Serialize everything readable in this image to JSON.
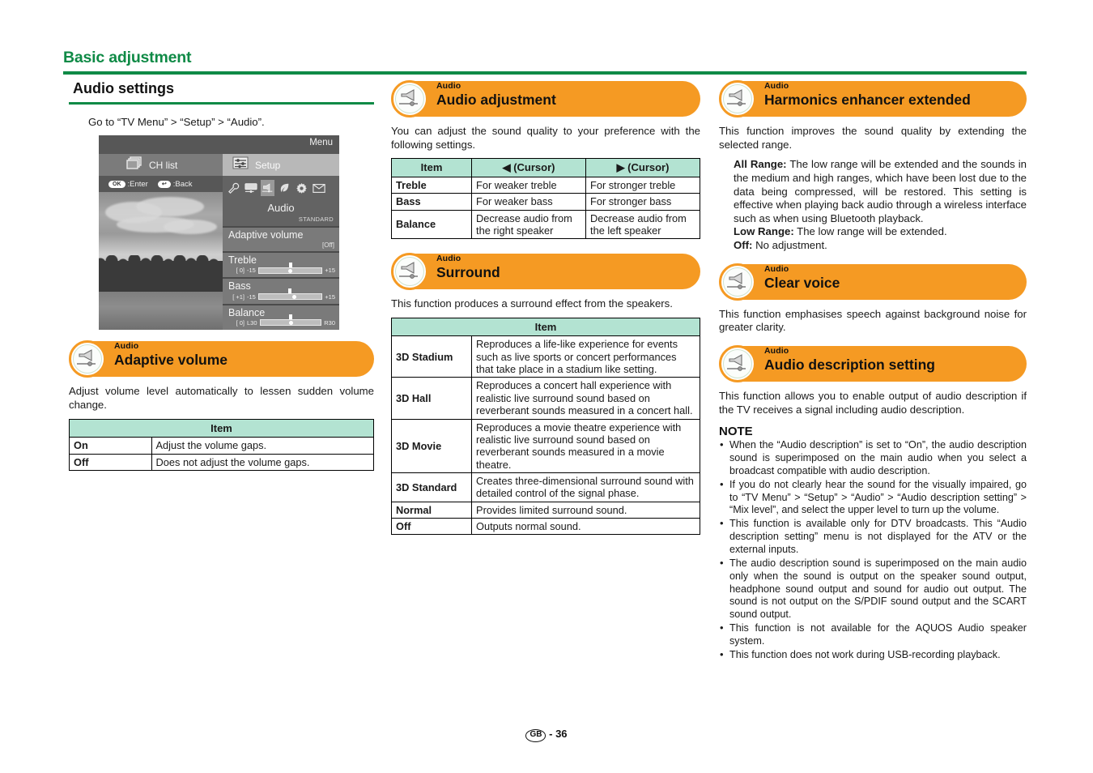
{
  "running_head": {
    "title": "Basic adjustment"
  },
  "footer": {
    "region": "GB",
    "separator": "-",
    "page_number": "36"
  },
  "left_column": {
    "section_title": "Audio settings",
    "intro": "Go to “TV Menu” > “Setup” > “Audio”.",
    "tv_osd": {
      "menu_label": "Menu",
      "tab_ch_list": "CH list",
      "tab_setup": "Setup",
      "hint_ok_key": "OK",
      "hint_ok_label": ":Enter",
      "hint_back_key": "↩",
      "hint_back_label": ":Back",
      "icons": [
        "wrench-icon",
        "picture-icon",
        "audio-icon",
        "eco-icon",
        "gear-icon",
        "mail-icon"
      ],
      "selected_icon_index": 2,
      "category_name": "Audio",
      "picture_mode": "STANDARD",
      "options": [
        {
          "label": "Adaptive volume",
          "value": "[Off]"
        }
      ],
      "sliders": [
        {
          "label": "Treble",
          "value": "[  0]",
          "min_label": "-15",
          "max_label": "+15",
          "percent": 50
        },
        {
          "label": "Bass",
          "value": "[ +1]",
          "min_label": "-15",
          "max_label": "+15",
          "percent": 55
        },
        {
          "label": "Balance",
          "value": "[  0]",
          "min_label": "L30",
          "max_label": "R30",
          "percent": 50
        }
      ]
    },
    "adaptive_volume": {
      "category": "Audio",
      "title": "Adaptive volume",
      "description": "Adjust volume level automatically to lessen sudden volume change.",
      "table": {
        "header": "Item",
        "rows": [
          {
            "key": "On",
            "desc": "Adjust the volume gaps."
          },
          {
            "key": "Off",
            "desc": "Does not adjust the volume gaps."
          }
        ]
      }
    }
  },
  "middle_column": {
    "audio_adjustment": {
      "category": "Audio",
      "title": "Audio adjustment",
      "description": "You can adjust the sound quality to your preference with the following settings.",
      "table": {
        "headers": [
          "Item",
          "◀ (Cursor)",
          "▶ (Cursor)"
        ],
        "rows": [
          {
            "item": "Treble",
            "left": "For weaker treble",
            "right": "For stronger treble"
          },
          {
            "item": "Bass",
            "left": "For weaker bass",
            "right": "For stronger bass"
          },
          {
            "item": "Balance",
            "left": "Decrease audio from the right speaker",
            "right": "Decrease audio from the left speaker"
          }
        ]
      }
    },
    "surround": {
      "category": "Audio",
      "title": "Surround",
      "description": "This function produces a surround effect from the speakers.",
      "table": {
        "header": "Item",
        "rows": [
          {
            "key": "3D Stadium",
            "desc": "Reproduces a life-like experience for events such as live sports or concert performances that take place in a stadium like setting."
          },
          {
            "key": "3D Hall",
            "desc": "Reproduces a concert hall experience with realistic live surround sound based on reverberant sounds measured in a concert hall."
          },
          {
            "key": "3D Movie",
            "desc": "Reproduces a movie theatre experience with realistic live surround sound based on reverberant sounds measured in a movie theatre."
          },
          {
            "key": "3D Standard",
            "desc": "Creates three-dimensional surround sound with detailed control of the signal phase."
          },
          {
            "key": "Normal",
            "desc": "Provides limited surround sound."
          },
          {
            "key": "Off",
            "desc": "Outputs normal sound."
          }
        ]
      }
    }
  },
  "right_column": {
    "harmonics_enhancer": {
      "category": "Audio",
      "title": "Harmonics enhancer extended",
      "description": "This function improves the sound quality by extending the selected range.",
      "options": [
        {
          "term": "All Range:",
          "text": " The low range will be extended and the sounds in the medium and high ranges, which have been lost due to the data being compressed, will be restored. This setting is effective when playing back audio through a wireless interface such as when using Bluetooth playback."
        },
        {
          "term": "Low Range:",
          "text": " The low range will be extended."
        },
        {
          "term": "Off:",
          "text": " No adjustment."
        }
      ]
    },
    "clear_voice": {
      "category": "Audio",
      "title": "Clear voice",
      "description": "This function emphasises speech against background noise for greater clarity."
    },
    "audio_description": {
      "category": "Audio",
      "title": "Audio description setting",
      "description": "This function allows you to enable output of audio description if the TV receives a signal including audio description.",
      "note_title": "NOTE",
      "notes": [
        "When the “Audio description” is set to “On”, the audio description sound is superimposed on the main audio when you select a broadcast compatible with audio description.",
        "If you do not clearly hear the sound for the visually impaired, go to “TV Menu” > “Setup” > “Audio” > “Audio description setting” > “Mix level”, and select the upper level to turn up the volume.",
        "This function is available only for DTV broadcasts. This “Audio description setting” menu is not displayed for the ATV or the external inputs.",
        "The audio description sound is superimposed on the main audio only when the sound is output on the speaker sound output, headphone sound output and sound for audio out output. The sound is not output on the S/PDIF sound output and the SCART sound output.",
        "This function is not available for the AQUOS Audio speaker system.",
        "This function does not work during USB-recording playback."
      ]
    }
  },
  "colors": {
    "heading_green": "#0f8a46",
    "banner_orange": "#f59a23",
    "table_header_mint": "#b3e3d2"
  }
}
